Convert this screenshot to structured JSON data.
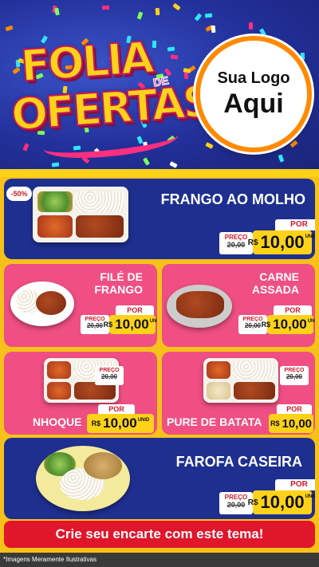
{
  "header": {
    "title_line1": "FOLIA",
    "title_de": "DE",
    "title_line2": "OFERTAS",
    "logo_line1": "Sua Logo",
    "logo_line2": "Aqui"
  },
  "badge": "-50%",
  "price_labels": {
    "por": "POR",
    "preco": "PREÇO",
    "currency": "R$",
    "unit": "UNID"
  },
  "products": [
    {
      "name": "FRANGO AO MOLHO",
      "old_price": "20,00",
      "price": "10,00"
    },
    {
      "name_line1": "FILÉ DE",
      "name_line2": "FRANGO",
      "old_price": "20,00",
      "price": "10,00"
    },
    {
      "name_line1": "CARNE",
      "name_line2": "ASSADA",
      "old_price": "20,00",
      "price": "10,00"
    },
    {
      "name": "NHOQUE",
      "old_price": "20,00",
      "price": "10,00"
    },
    {
      "name": "PURE DE BATATA",
      "old_price": "20,00",
      "price": "10,00"
    },
    {
      "name": "FAROFA CASEIRA",
      "old_price": "20,00",
      "price": "10,00"
    }
  ],
  "cta": "Crie seu encarte com este tema!",
  "footer": "*Imagens Meramente Ilustrativas",
  "colors": {
    "blue": "#1f2f8f",
    "pink": "#ef4f83",
    "yellow": "#ffd21a",
    "red": "#e0162b"
  }
}
